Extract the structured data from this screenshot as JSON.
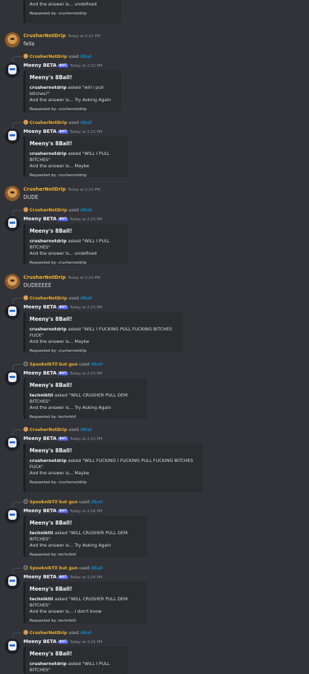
{
  "top_embed": {
    "answer_line": "And the answer is... undefined",
    "footer": "Requested by: crushernotdrip"
  },
  "messages": [
    {
      "type": "user",
      "author": "CrusherNotDrip",
      "time": "Today at 2:22 PM",
      "text": "fella"
    },
    {
      "type": "bot",
      "reply_user": "CrusherNotDrip",
      "reply_used": "used",
      "reply_cmd": "/8ball",
      "author": "Meeny BETA",
      "bot_tag": "BOT",
      "time": "Today at 2:22 PM",
      "embed_title": "Meeny's 8Ball!",
      "asker": "crushernotdrip",
      "asked_text": " asked \"will i pull bitches?\"",
      "answer": "And the answer is... Try Asking Again",
      "footer": "Requested by: crushernotdrip"
    },
    {
      "type": "bot",
      "reply_user": "CrusherNotDrip",
      "reply_used": "used",
      "reply_cmd": "/8ball",
      "author": "Meeny BETA",
      "bot_tag": "BOT",
      "time": "Today at 2:23 PM",
      "embed_title": "Meeny's 8Ball!",
      "asker": "crushernotdrip",
      "asked_text": " asked \"WILL I PULL BITCHES\"",
      "answer": "And the answer is... Maybe",
      "footer": "Requested by: crushernotdrip"
    },
    {
      "type": "user",
      "author": "CrusherNotDrip",
      "time": "Today at 2:23 PM",
      "text": "DUDE"
    },
    {
      "type": "bot",
      "reply_user": "CrusherNotDrip",
      "reply_used": "used",
      "reply_cmd": "/8ball",
      "author": "Meeny BETA",
      "bot_tag": "BOT",
      "time": "Today at 2:23 PM",
      "embed_title": "Meeny's 8Ball!",
      "asker": "crushernotdrip",
      "asked_text": " asked \"WILL I PULL BITCHES\"",
      "answer": "And the answer is... undefined",
      "footer": "Requested by: crushernotdrip"
    },
    {
      "type": "user",
      "author": "CrusherNotDrip",
      "time": "Today at 2:23 PM",
      "text": "DUDEEEEE"
    },
    {
      "type": "bot",
      "reply_user": "CrusherNotDrip",
      "reply_used": "used",
      "reply_cmd": "/8ball",
      "author": "Meeny BETA",
      "bot_tag": "BOT",
      "time": "Today at 2:23 PM",
      "embed_title": "Meeny's 8Ball!",
      "asker": "crushernotdrip",
      "asked_text": " asked \"WILL I FUCKING PULL FUCKING BITCHES FUCK\"",
      "answer": "And the answer is... Maybe",
      "footer": "Requested by: crushernotdrip"
    },
    {
      "type": "bot",
      "reply_user": "SpooknikTil but gun",
      "reply_used": "used",
      "reply_cmd": "/8ball",
      "author": "Meeny BETA",
      "bot_tag": "BOT",
      "time": "Today at 2:23 PM",
      "embed_title": "Meeny's 8Ball!",
      "asker": "techniktil",
      "asked_text": " asked \"WILL CRUSHER PULL DEM BITCHES\"",
      "answer": "And the answer is... Try Asking Again",
      "footer": "Requested by: techniktil"
    },
    {
      "type": "bot",
      "reply_user": "CrusherNotDrip",
      "reply_used": "used",
      "reply_cmd": "/8ball",
      "author": "Meeny BETA",
      "bot_tag": "BOT",
      "time": "Today at 2:23 PM",
      "embed_title": "Meeny's 8Ball!",
      "asker": "crushernotdrip",
      "asked_text": " asked \"WILL FUCKING I FUCKING PULL FUCKING BITCHES FUCK\"",
      "answer": "And the answer is... Maybe",
      "footer": "Requested by: crushernotdrip"
    },
    {
      "type": "bot",
      "reply_user": "SpooknikTil but gun",
      "reply_used": "used",
      "reply_cmd": "/8ball",
      "author": "Meeny BETA",
      "bot_tag": "BOT",
      "time": "Today at 2:24 PM",
      "embed_title": "Meeny's 8Ball!",
      "asker": "techniktil",
      "asked_text": " asked \"WILL CRUSHER PULL DEM BITCHES\"",
      "answer": "And the answer is... Try Asking Again",
      "footer": "Requested by: techniktil"
    },
    {
      "type": "bot",
      "reply_user": "SpooknikTil but gun",
      "reply_used": "used",
      "reply_cmd": "/8ball",
      "author": "Meeny BETA",
      "bot_tag": "BOT",
      "time": "Today at 2:24 PM",
      "embed_title": "Meeny's 8Ball!",
      "asker": "techniktil",
      "asked_text": " asked \"WILL CRUSHER PULL DEM BITCHES\"",
      "answer": "And the answer is... I don't know",
      "footer": "Requested by: techniktil"
    },
    {
      "type": "bot",
      "reply_user": "CrusherNotDrip",
      "reply_used": "used",
      "reply_cmd": "/8ball",
      "author": "Meeny BETA",
      "bot_tag": "BOT",
      "time": "Today at 2:24 PM",
      "embed_title": "Meeny's 8Ball!",
      "asker": "crushernotdrip",
      "asked_text": " asked \"WILL I PULL BITCHES\"",
      "answer": "",
      "footer": ""
    }
  ]
}
